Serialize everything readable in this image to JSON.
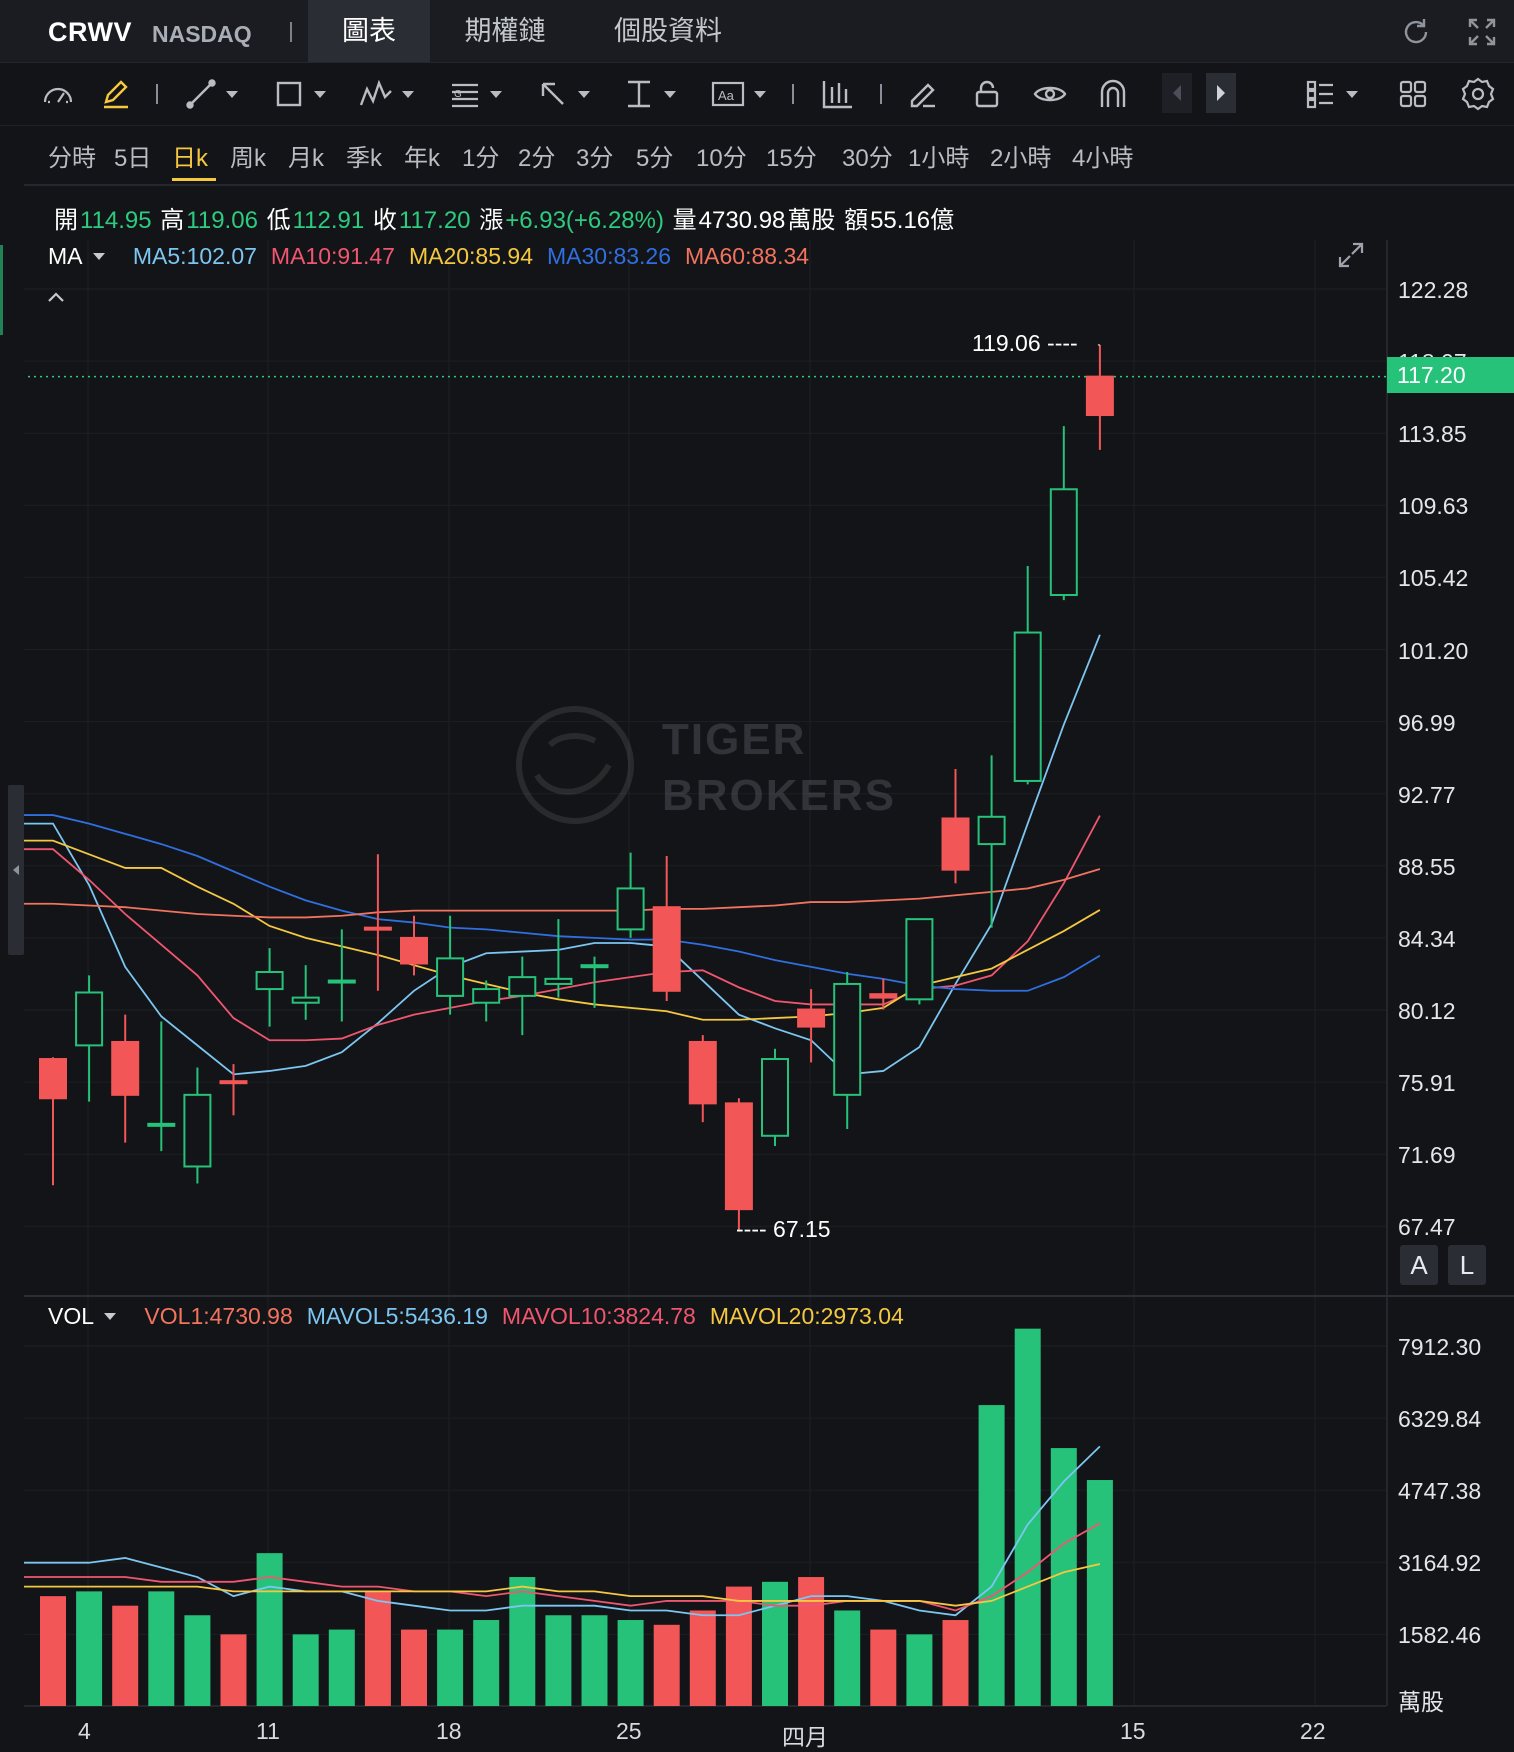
{
  "header": {
    "symbol": "CRWV",
    "exchange": "NASDAQ",
    "tabs": [
      "圖表",
      "期權鏈",
      "個股資料"
    ],
    "active_tab": 0
  },
  "toolbar": {
    "icons": [
      "speedometer-icon",
      "pencil-edit-icon",
      "line-tool-icon",
      "rectangle-tool-icon",
      "pattern-tool-icon",
      "fib-tool-icon",
      "arrow-tool-icon",
      "measure-tool-icon",
      "text-tool-icon",
      "indicator-icon",
      "eraser-icon",
      "lock-icon",
      "eye-icon",
      "magnet-icon",
      "prev-arrow-icon",
      "next-arrow-icon",
      "layout-list-icon",
      "grid-icon",
      "settings-icon"
    ]
  },
  "periods": [
    "分時",
    "5日",
    "日k",
    "周k",
    "月k",
    "季k",
    "年k",
    "1分",
    "2分",
    "3分",
    "5分",
    "10分",
    "15分",
    "30分",
    "1小時",
    "2小時",
    "4小時"
  ],
  "active_period": 2,
  "ohlc": {
    "open_label": "開",
    "open": "114.95",
    "high_label": "高",
    "high": "119.06",
    "low_label": "低",
    "low": "112.91",
    "close_label": "收",
    "close": "117.20",
    "change_label": "漲",
    "change": "+6.93(+6.28%)",
    "volume_label": "量",
    "volume": "4730.98",
    "volume_unit": "萬股",
    "amount_label": "額",
    "amount": "55.16億"
  },
  "ma_legend": {
    "label": "MA",
    "items": [
      {
        "text": "MA5:102.07",
        "color": "#7cc6f2"
      },
      {
        "text": "MA10:91.47",
        "color": "#f0566f"
      },
      {
        "text": "MA20:85.94",
        "color": "#f5c842"
      },
      {
        "text": "MA30:83.26",
        "color": "#2f6fe0"
      },
      {
        "text": "MA60:88.34",
        "color": "#f2735e"
      }
    ]
  },
  "vol_legend": {
    "label": "VOL",
    "items": [
      {
        "text": "VOL1:4730.98",
        "color": "#f2735e"
      },
      {
        "text": "MAVOL5:5436.19",
        "color": "#7cc6f2"
      },
      {
        "text": "MAVOL10:3824.78",
        "color": "#f0566f"
      },
      {
        "text": "MAVOL20:2973.04",
        "color": "#f5c842"
      }
    ]
  },
  "price_axis": [
    "122.28",
    "118.07",
    "113.85",
    "109.63",
    "105.42",
    "101.20",
    "96.99",
    "92.77",
    "88.55",
    "84.34",
    "80.12",
    "75.91",
    "71.69",
    "67.47"
  ],
  "last_price": "117.20",
  "high_annotation": "119.06 ----",
  "low_annotation": "---- 67.15",
  "vol_axis": [
    "7912.30",
    "6329.84",
    "4747.38",
    "3164.92",
    "1582.46"
  ],
  "vol_unit": "萬股",
  "x_axis": [
    "4",
    "11",
    "18",
    "25",
    "四月",
    "15",
    "22"
  ],
  "scale_buttons": [
    "A",
    "L"
  ],
  "watermark": {
    "line1": "TIGER",
    "line2": "BROKERS"
  },
  "colors": {
    "up": "#26c27a",
    "down": "#f25656",
    "bg": "#131417"
  },
  "chart_data": {
    "type": "candlestick",
    "title": "",
    "ylim": [
      67.47,
      122.28
    ],
    "candles": [
      {
        "o": 77.2,
        "h": 77.3,
        "l": 69.8,
        "c": 74.9
      },
      {
        "o": 78.0,
        "h": 82.1,
        "l": 74.7,
        "c": 81.1
      },
      {
        "o": 78.2,
        "h": 79.8,
        "l": 72.3,
        "c": 75.1
      },
      {
        "o": 73.4,
        "h": 79.4,
        "l": 71.8,
        "c": 73.4
      },
      {
        "o": 70.9,
        "h": 76.7,
        "l": 69.9,
        "c": 75.1
      },
      {
        "o": 75.9,
        "h": 76.9,
        "l": 73.9,
        "c": 75.8
      },
      {
        "o": 81.3,
        "h": 83.7,
        "l": 79.1,
        "c": 82.3
      },
      {
        "o": 80.5,
        "h": 82.7,
        "l": 79.5,
        "c": 80.8
      },
      {
        "o": 81.8,
        "h": 84.8,
        "l": 79.4,
        "c": 81.8
      },
      {
        "o": 84.9,
        "h": 89.2,
        "l": 81.2,
        "c": 84.8
      },
      {
        "o": 84.3,
        "h": 85.6,
        "l": 82.1,
        "c": 82.8
      },
      {
        "o": 80.9,
        "h": 85.6,
        "l": 79.8,
        "c": 83.1
      },
      {
        "o": 80.5,
        "h": 81.8,
        "l": 79.4,
        "c": 81.3
      },
      {
        "o": 80.9,
        "h": 83.2,
        "l": 78.6,
        "c": 82.0
      },
      {
        "o": 81.6,
        "h": 85.4,
        "l": 80.8,
        "c": 81.9
      },
      {
        "o": 82.7,
        "h": 83.2,
        "l": 80.2,
        "c": 82.7
      },
      {
        "o": 84.8,
        "h": 89.3,
        "l": 84.3,
        "c": 87.2
      },
      {
        "o": 86.1,
        "h": 89.1,
        "l": 80.6,
        "c": 81.2
      },
      {
        "o": 78.2,
        "h": 78.6,
        "l": 73.5,
        "c": 74.6
      },
      {
        "o": 74.6,
        "h": 74.9,
        "l": 67.15,
        "c": 68.4
      },
      {
        "o": 72.7,
        "h": 77.8,
        "l": 72.1,
        "c": 77.2
      },
      {
        "o": 80.1,
        "h": 81.3,
        "l": 77.0,
        "c": 79.1
      },
      {
        "o": 75.1,
        "h": 82.3,
        "l": 73.1,
        "c": 81.6
      },
      {
        "o": 81.0,
        "h": 81.9,
        "l": 80.1,
        "c": 80.8
      },
      {
        "o": 80.7,
        "h": 81.4,
        "l": 80.4,
        "c": 85.4
      },
      {
        "o": 91.3,
        "h": 94.2,
        "l": 87.5,
        "c": 88.3
      },
      {
        "o": 89.8,
        "h": 95.0,
        "l": 84.9,
        "c": 91.4
      },
      {
        "o": 93.5,
        "h": 106.1,
        "l": 93.3,
        "c": 102.2
      },
      {
        "o": 104.4,
        "h": 114.3,
        "l": 104.1,
        "c": 110.6
      },
      {
        "o": 117.2,
        "h": 119.06,
        "l": 112.91,
        "c": 114.95
      }
    ],
    "ma_lines": [
      {
        "name": "MA5",
        "values": [
          91.0,
          87.4,
          82.6,
          79.7,
          78.0,
          76.3,
          76.5,
          76.8,
          77.6,
          79.3,
          81.2,
          82.6,
          83.4,
          83.5,
          83.6,
          84.0,
          84.0,
          83.8,
          81.8,
          79.8,
          79.0,
          78.3,
          76.3,
          76.5,
          77.9,
          81.6,
          85.1,
          91.0,
          96.8,
          102.07
        ]
      },
      {
        "name": "MA10",
        "values": [
          89.5,
          87.7,
          85.7,
          83.9,
          82.1,
          79.6,
          78.3,
          78.3,
          78.4,
          79.2,
          79.8,
          80.2,
          80.6,
          80.9,
          81.3,
          81.7,
          82.0,
          82.3,
          82.4,
          81.4,
          80.6,
          80.4,
          80.4,
          80.4,
          81.3,
          81.5,
          82.1,
          84.1,
          87.5,
          91.47
        ]
      },
      {
        "name": "MA20",
        "values": [
          90.0,
          89.2,
          88.4,
          88.4,
          87.3,
          86.3,
          85.0,
          84.3,
          83.8,
          83.3,
          82.7,
          82.1,
          81.6,
          81.1,
          80.7,
          80.4,
          80.2,
          80.0,
          79.5,
          79.5,
          79.6,
          79.7,
          79.9,
          80.2,
          81.5,
          82.0,
          82.5,
          83.6,
          84.7,
          85.94
        ]
      },
      {
        "name": "MA30",
        "values": [
          91.5,
          91.0,
          90.4,
          89.8,
          89.1,
          88.2,
          87.3,
          86.5,
          85.9,
          85.4,
          85.2,
          84.9,
          84.8,
          84.6,
          84.4,
          84.3,
          84.2,
          84.2,
          83.9,
          83.5,
          83.0,
          82.6,
          82.2,
          81.9,
          81.5,
          81.3,
          81.2,
          81.2,
          82.0,
          83.26
        ]
      },
      {
        "name": "MA60",
        "values": [
          86.3,
          86.2,
          86.1,
          85.9,
          85.7,
          85.6,
          85.5,
          85.5,
          85.6,
          85.8,
          85.9,
          85.9,
          85.9,
          85.9,
          85.9,
          85.9,
          85.9,
          86.0,
          86.0,
          86.1,
          86.2,
          86.4,
          86.4,
          86.5,
          86.6,
          86.8,
          87.0,
          87.2,
          87.7,
          88.34
        ]
      }
    ],
    "volume": {
      "ylim": [
        0,
        8500
      ],
      "bars": [
        2300,
        2400,
        2100,
        2400,
        1900,
        1500,
        3200,
        1500,
        1600,
        2400,
        1600,
        1600,
        1800,
        2700,
        1900,
        1900,
        1800,
        1700,
        2000,
        2500,
        2600,
        2700,
        2000,
        1600,
        1500,
        1800,
        6300,
        7900,
        5400,
        4730.98
      ],
      "up": [
        false,
        true,
        false,
        true,
        true,
        false,
        true,
        true,
        true,
        false,
        false,
        true,
        true,
        true,
        true,
        true,
        true,
        false,
        false,
        false,
        true,
        false,
        true,
        false,
        true,
        false,
        true,
        true,
        true,
        true
      ],
      "mavol5": [
        3000,
        3000,
        3100,
        2900,
        2700,
        2300,
        2500,
        2400,
        2400,
        2200,
        2100,
        2000,
        2000,
        2100,
        2100,
        2100,
        2000,
        2000,
        1900,
        1900,
        2100,
        2300,
        2300,
        2200,
        2000,
        1900,
        2500,
        3800,
        4700,
        5436.19
      ],
      "mavol10": [
        2700,
        2700,
        2700,
        2600,
        2600,
        2600,
        2700,
        2600,
        2500,
        2500,
        2400,
        2400,
        2300,
        2400,
        2300,
        2200,
        2100,
        2200,
        2200,
        2200,
        2100,
        2100,
        2200,
        2200,
        2200,
        2000,
        2300,
        2800,
        3400,
        3824.78
      ],
      "mavol20": [
        2500,
        2500,
        2500,
        2500,
        2500,
        2400,
        2400,
        2400,
        2400,
        2400,
        2400,
        2400,
        2400,
        2500,
        2400,
        2400,
        2300,
        2300,
        2300,
        2200,
        2200,
        2200,
        2200,
        2200,
        2200,
        2100,
        2200,
        2500,
        2800,
        2973.04
      ]
    }
  }
}
